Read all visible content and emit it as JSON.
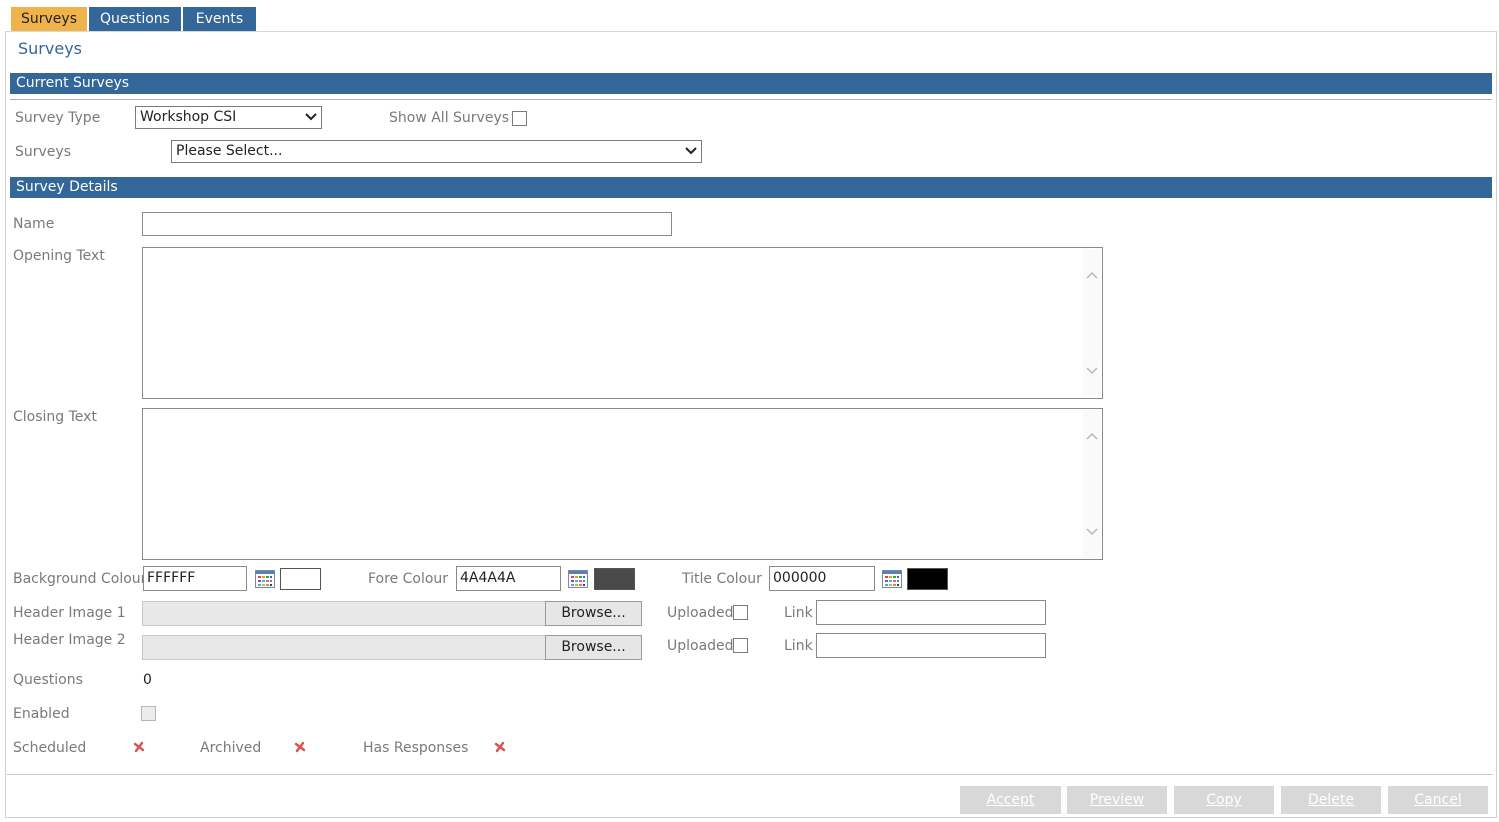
{
  "tabs": [
    "Surveys",
    "Questions",
    "Events"
  ],
  "page_title": "Surveys",
  "current_surveys": {
    "header": "Current Surveys",
    "survey_type_label": "Survey Type",
    "survey_type_value": "Workshop CSI",
    "show_all_label": "Show All Surveys",
    "surveys_label": "Surveys",
    "surveys_value": "Please Select..."
  },
  "survey_details": {
    "header": "Survey Details",
    "name_label": "Name",
    "opening_text_label": "Opening Text",
    "closing_text_label": "Closing Text",
    "background_colour_label": "Background Colour",
    "background_colour_value": "FFFFFF",
    "background_swatch": "#FFFFFF",
    "fore_colour_label": "Fore Colour",
    "fore_colour_value": "4A4A4A",
    "fore_swatch": "#4A4A4A",
    "title_colour_label": "Title Colour",
    "title_colour_value": "000000",
    "title_swatch": "#000000",
    "header_image_1_label": "Header Image 1",
    "header_image_2_label": "Header Image 2",
    "browse_label": "Browse...",
    "uploaded_label": "Uploaded",
    "link_label": "Link",
    "questions_label": "Questions",
    "questions_value": "0",
    "enabled_label": "Enabled",
    "scheduled_label": "Scheduled",
    "archived_label": "Archived",
    "has_responses_label": "Has Responses"
  },
  "buttons": {
    "accept": "Accept",
    "preview": "Preview",
    "copy": "Copy",
    "delete": "Delete",
    "cancel": "Cancel"
  },
  "colors": {
    "accent": "#336699",
    "active_tab": "#F0B24A",
    "disabled_button": "#D8D8D8",
    "x_mark": "#D9534F"
  }
}
